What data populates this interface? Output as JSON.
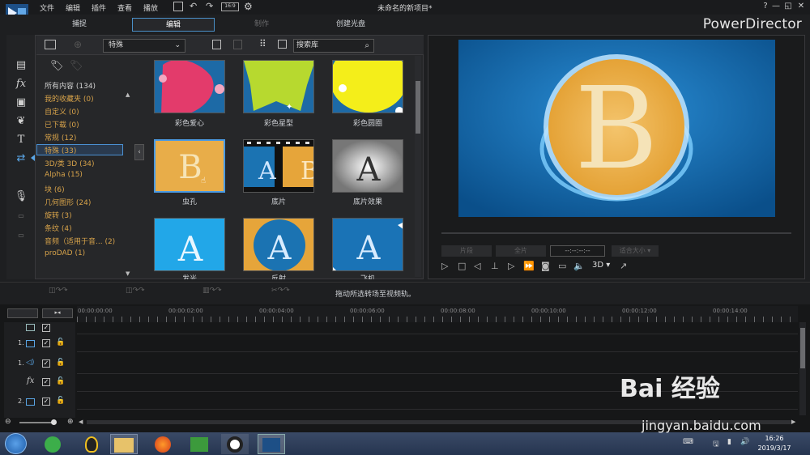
{
  "titlebar": {
    "menus": [
      "文件",
      "编辑",
      "插件",
      "查看",
      "播放"
    ],
    "title": "未命名的新项目*",
    "buttons": [
      "?",
      "—",
      "◱",
      "✕"
    ]
  },
  "modes": {
    "capture": "捕捉",
    "edit": "编辑",
    "produce": "制作",
    "disc": "创建光盘"
  },
  "brand": "PowerDirector",
  "library": {
    "category_select": "特殊",
    "search_placeholder": "搜索库",
    "categories": [
      {
        "label": "所有内容 (134)",
        "color": "white"
      },
      {
        "label": "我的收藏夹  (0)",
        "color": "orange"
      },
      {
        "label": "自定义  (0)",
        "color": "orange"
      },
      {
        "label": "已下载  (0)",
        "color": "orange"
      },
      {
        "label": "常规  (12)",
        "color": "orange"
      },
      {
        "label": "特殊  (33)",
        "color": "orange"
      },
      {
        "label": "3D/类 3D  (34)",
        "color": "orange"
      },
      {
        "label": "Alpha  (15)",
        "color": "orange"
      },
      {
        "label": "块  (6)",
        "color": "orange"
      },
      {
        "label": "几何图形  (24)",
        "color": "orange"
      },
      {
        "label": "旋转  (3)",
        "color": "orange"
      },
      {
        "label": "条纹  (4)",
        "color": "orange"
      },
      {
        "label": "音频（适用于音...  (2)",
        "color": "orange"
      },
      {
        "label": "proDAD  (1)",
        "color": "orange"
      }
    ],
    "thumbnails": [
      {
        "label": "彩色爱心"
      },
      {
        "label": "彩色星型"
      },
      {
        "label": "彩色圆圈"
      },
      {
        "label": "虫孔"
      },
      {
        "label": "底片"
      },
      {
        "label": "底片效果"
      },
      {
        "label": "发光"
      },
      {
        "label": "反射"
      },
      {
        "label": "飞机"
      }
    ]
  },
  "preview": {
    "timecode": "--:--:--:--",
    "btn_clip": "片段",
    "btn_movie": "全片",
    "fit": "适合大小",
    "mode_3d": "3D"
  },
  "timeline": {
    "hint": "拖动所选转场至视频轨。",
    "ticks": [
      "00:00:00:00",
      "00:00:02:00",
      "00:00:04:00",
      "00:00:06:00",
      "00:00:08:00",
      "00:00:10:00",
      "00:00:12:00",
      "00:00:14:00"
    ],
    "tracks": [
      {
        "num": "",
        "type": "video-all"
      },
      {
        "num": "1.",
        "type": "video"
      },
      {
        "num": "1.",
        "type": "audio"
      },
      {
        "num": "",
        "type": "fx"
      },
      {
        "num": "2.",
        "type": "video"
      }
    ]
  },
  "taskbar": {
    "time": "16:26",
    "date": "2019/3/17"
  },
  "watermark": {
    "brand": "Bai 经验",
    "url": "jingyan.baidu.com"
  }
}
